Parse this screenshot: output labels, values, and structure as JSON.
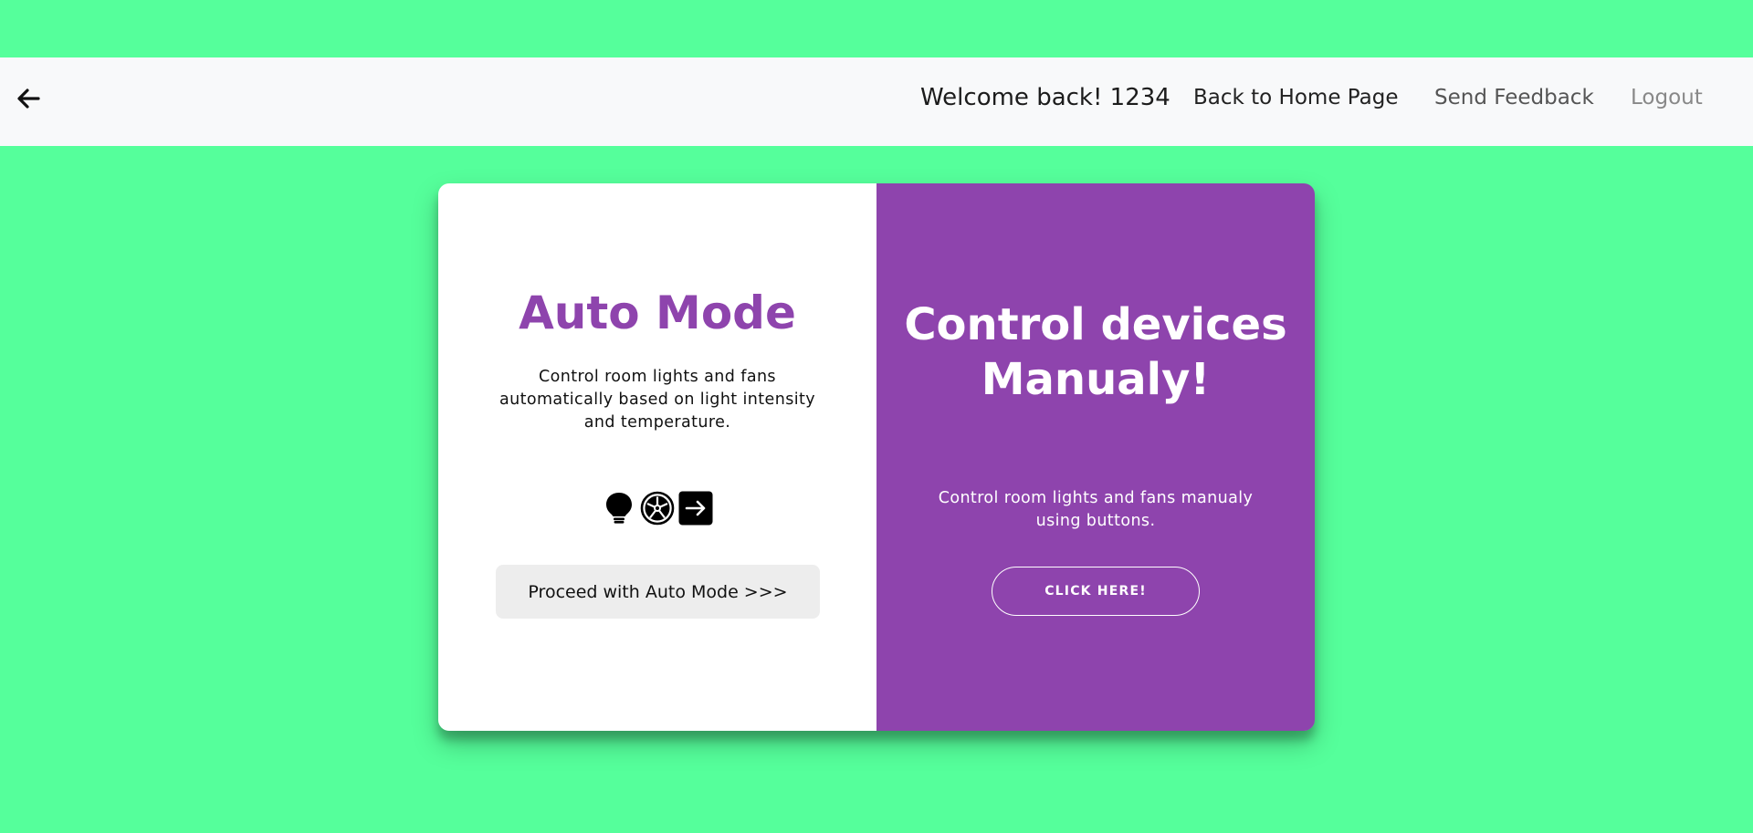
{
  "navbar": {
    "welcome": "Welcome back! 1234",
    "links": [
      {
        "label": "Back to Home Page"
      },
      {
        "label": "Send Feedback"
      },
      {
        "label": "Logout"
      }
    ]
  },
  "auto_panel": {
    "title": "Auto Mode",
    "description": "Control room lights and fans automatically based on light intensity and temperature.",
    "icons": [
      "lightbulb-icon",
      "fan-icon",
      "arrow-right-square-icon"
    ],
    "button_label": "Proceed with Auto Mode >>>"
  },
  "manual_panel": {
    "title": "Control devices Manualy!",
    "description": "Control room lights and fans manualy using buttons.",
    "button_label": "Click here!"
  },
  "colors": {
    "page_background": "#55ff9b",
    "navbar_background": "#f8f9fa",
    "accent_purple": "#8e44ad",
    "auto_button_background": "#ededed"
  }
}
